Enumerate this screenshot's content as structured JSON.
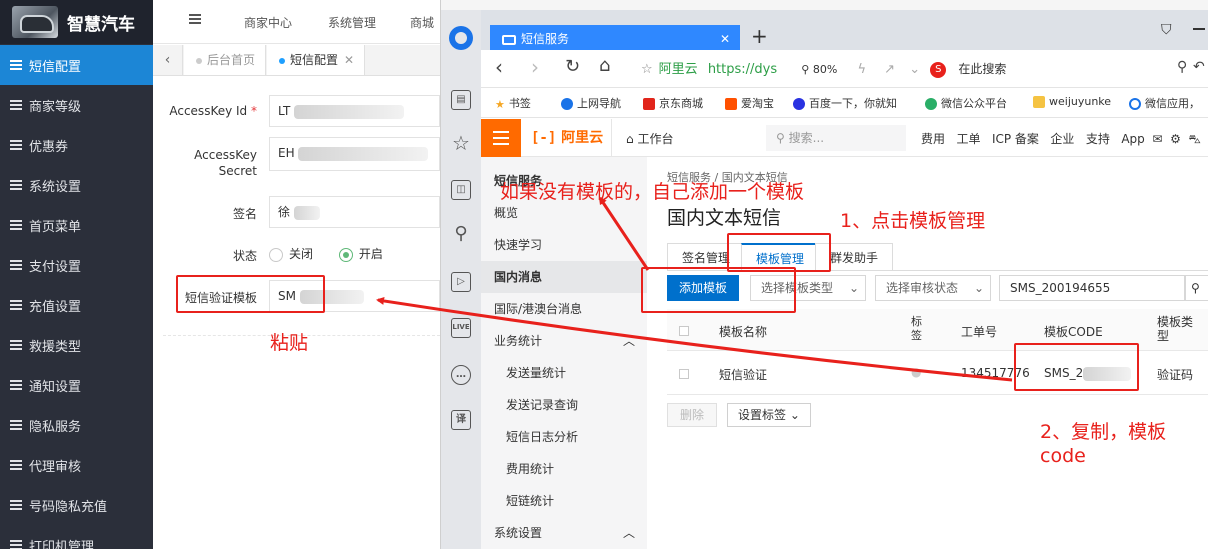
{
  "admin": {
    "app_name": "智慧汽车",
    "top_nav": [
      "商家中心",
      "系统管理",
      "商城"
    ],
    "tabs": [
      "后台首页",
      "短信配置"
    ],
    "sidebar": [
      "短信配置",
      "商家等级",
      "优惠券",
      "系统设置",
      "首页菜单",
      "支付设置",
      "充值设置",
      "救援类型",
      "通知设置",
      "隐私服务",
      "代理审核",
      "号码隐私充值",
      "打印机管理"
    ],
    "form": {
      "accesskey_id_label": "AccessKey Id",
      "accesskey_id_value": "LT",
      "accesskey_secret_label_1": "AccessKey",
      "accesskey_secret_label_2": "Secret",
      "accesskey_secret_value": "EH",
      "sign_label": "签名",
      "sign_value": "徐",
      "status_label": "状态",
      "status_off": "关闭",
      "status_on": "开启",
      "template_label": "短信验证模板",
      "template_value": "SM"
    }
  },
  "browser": {
    "tab_title": "短信服务",
    "aliyun_label": "阿里云",
    "url": "https://dys",
    "zoom": "80%",
    "search_placeholder": "在此搜索",
    "bookmarks": [
      "书签",
      "上网导航",
      "京东商城",
      "爱淘宝",
      "百度一下，你就知",
      "微信公众平台",
      "weijuyunke",
      "微信应用，"
    ]
  },
  "aliyun": {
    "logo": "阿里云",
    "workbench": "工作台",
    "search": "搜索...",
    "top_links": [
      "费用",
      "工单",
      "ICP 备案",
      "企业",
      "支持",
      "App"
    ],
    "side": {
      "title": "短信服务",
      "items": [
        "概览",
        "快速学习",
        "国内消息",
        "国际/港澳台消息",
        "业务统计",
        "发送量统计",
        "发送记录查询",
        "短信日志分析",
        "费用统计",
        "短链统计",
        "系统设置"
      ]
    },
    "breadcrumb": "短信服务  /  国内文本短信",
    "page_title": "国内文本短信",
    "tabs": [
      "签名管理",
      "模板管理",
      "群发助手"
    ],
    "add_template": "添加模板",
    "filter_type": "选择模板类型",
    "filter_status": "选择审核状态",
    "search_value": "SMS_200194655",
    "table": {
      "headers": [
        "模板名称",
        "标签",
        "工单号",
        "模板CODE",
        "模板类型"
      ],
      "row": {
        "name": "短信验证",
        "ticket": "134517776",
        "code": "SMS_2",
        "type": "验证码"
      }
    },
    "delete_btn": "删除",
    "set_tag_btn": "设置标签"
  },
  "annotations": {
    "no_template": "如果没有模板的，自己添加一个模板",
    "step1": "1、点击模板管理",
    "step2_line1": "2、复制，模板",
    "step2_line2": "code",
    "paste": "粘贴"
  }
}
